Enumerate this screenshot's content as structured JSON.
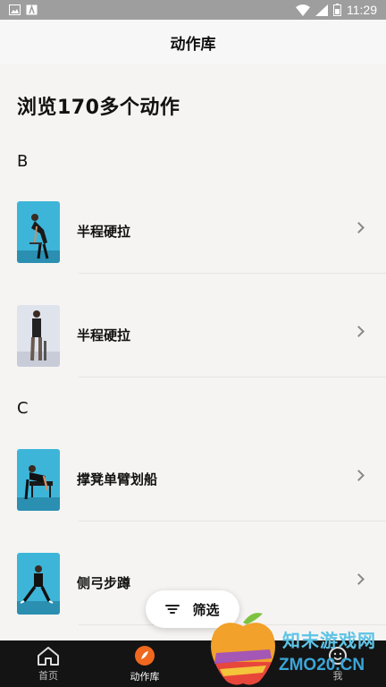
{
  "status_bar": {
    "time": "11:29"
  },
  "header": {
    "title": "动作库"
  },
  "page": {
    "heading": "浏览170多个动作"
  },
  "sections": [
    {
      "letter": "B",
      "items": [
        {
          "label": "半程硬拉"
        },
        {
          "label": "半程硬拉"
        }
      ]
    },
    {
      "letter": "C",
      "items": [
        {
          "label": "撑凳单臂划船"
        },
        {
          "label": "侧弓步蹲"
        }
      ]
    }
  ],
  "filter": {
    "label": "筛选",
    "icon": "filter-lines-icon"
  },
  "tabbar": {
    "tabs": [
      {
        "label": "首页",
        "icon": "home-icon"
      },
      {
        "label": "动作库",
        "icon": "exercise-library-icon"
      },
      {
        "label": "",
        "icon": ""
      },
      {
        "label": "我",
        "icon": "profile-icon"
      }
    ]
  },
  "watermark": {
    "line1": "知末游戏网",
    "line2": "ZMO20.CN"
  },
  "colors": {
    "accent": "#f0681e",
    "tabbar_bg": "#141414",
    "background": "#f5f4f2"
  }
}
